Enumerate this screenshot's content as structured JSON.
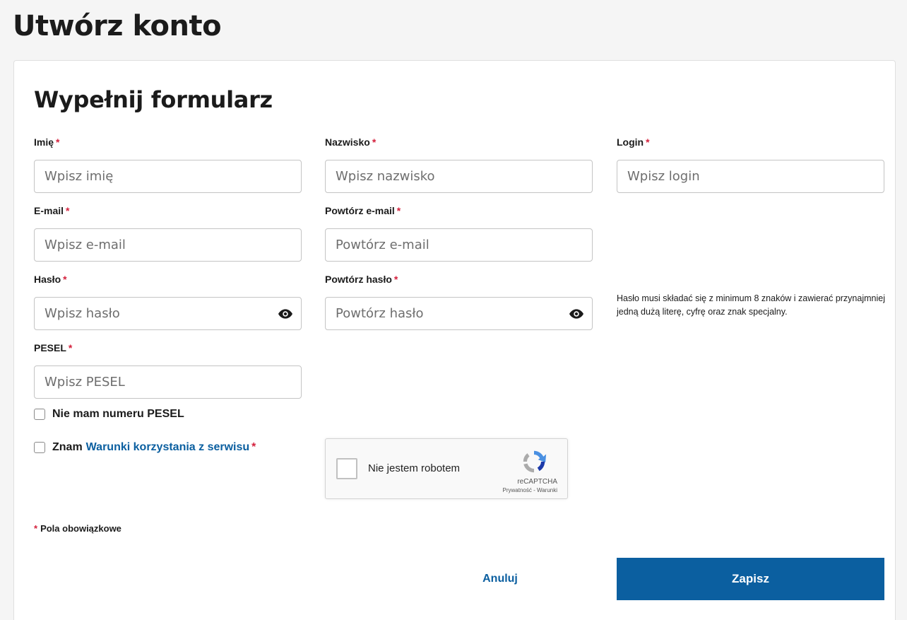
{
  "page": {
    "title": "Utwórz konto"
  },
  "form": {
    "title": "Wypełnij formularz",
    "required_mark": "*",
    "fields": {
      "first_name": {
        "label": "Imię",
        "placeholder": "Wpisz imię",
        "value": ""
      },
      "last_name": {
        "label": "Nazwisko",
        "placeholder": "Wpisz nazwisko",
        "value": ""
      },
      "login": {
        "label": "Login",
        "placeholder": "Wpisz login",
        "value": ""
      },
      "email": {
        "label": "E-mail",
        "placeholder": "Wpisz e-mail",
        "value": ""
      },
      "email_repeat": {
        "label": "Powtórz e-mail",
        "placeholder": "Powtórz e-mail",
        "value": ""
      },
      "password": {
        "label": "Hasło",
        "placeholder": "Wpisz hasło",
        "value": ""
      },
      "password_repeat": {
        "label": "Powtórz hasło",
        "placeholder": "Powtórz hasło",
        "value": ""
      },
      "pesel": {
        "label": "PESEL",
        "placeholder": "Wpisz PESEL",
        "value": ""
      }
    },
    "password_hint": "Hasło musi składać się z minimum 8 znaków i zawierać przynajmniej jedną dużą literę, cyfrę oraz znak specjalny.",
    "no_pesel_label": "Nie mam numeru PESEL",
    "terms": {
      "prefix": "Znam",
      "link": "Warunki korzystania z serwisu"
    },
    "recaptcha": {
      "label": "Nie jestem robotem",
      "brand": "reCAPTCHA",
      "links": "Prywatność - Warunki"
    },
    "required_note": "Pola obowiązkowe",
    "buttons": {
      "cancel": "Anuluj",
      "save": "Zapisz"
    }
  },
  "colors": {
    "accent": "#0b5fa0",
    "required": "#d4213d"
  },
  "icons": {
    "password_toggle": "eye-icon",
    "captcha_logo": "recaptcha-logo-icon"
  }
}
